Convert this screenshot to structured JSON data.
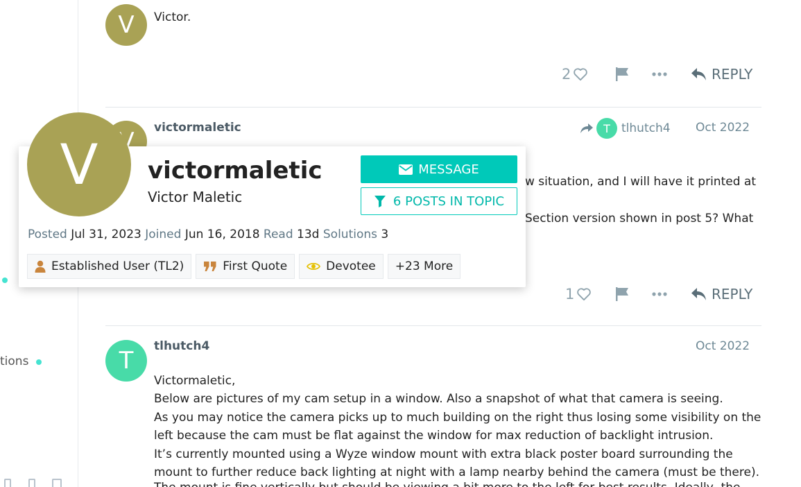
{
  "left_rail": {
    "partial_label": "tions"
  },
  "posts": [
    {
      "avatar_letter": "V",
      "avatar_color": "#a9a255",
      "body_lines": [
        "Victor."
      ],
      "likes": "2",
      "reply_label": "REPLY"
    },
    {
      "avatar_letter": "V",
      "avatar_color": "#a9a255",
      "username": "victormaletic",
      "reply_to": {
        "avatar_letter": "T",
        "avatar_color": "#48dba8",
        "name": "tlhutch4"
      },
      "date": "Oct 2022",
      "body_fragments": [
        "w situation, and I will have it printed at",
        "Section version shown in post 5? What"
      ],
      "likes": "1",
      "reply_label": "REPLY"
    },
    {
      "avatar_letter": "T",
      "avatar_color": "#48dba8",
      "username": "tlhutch4",
      "date": "Oct 2022",
      "body_lines": [
        "Victormaletic,",
        "Below are pictures of my cam setup in a window. Also a snapshot of what that camera is seeing.",
        "As you may notice the camera picks up to much building on the right thus losing some visibility on the",
        "left because the cam must be flat against the window for max reduction of backlight intrusion.",
        "It’s currently mounted using a Wyze window mount with extra black poster board surrounding the",
        "mount to further reduce back lighting at night with a lamp nearby behind the camera (must be there).",
        "The mount is fine vertically but should be viewing a bit more to the left for best results. Ideally, the"
      ]
    }
  ],
  "user_card": {
    "avatar_letter": "V",
    "avatar_color": "#a9a255",
    "username": "victormaletic",
    "full_name": "Victor Maletic",
    "message_button": "MESSAGE",
    "posts_in_topic_button": "6 POSTS IN TOPIC",
    "meta": {
      "posted_label": "Posted",
      "posted_value": "Jul 31, 2023",
      "joined_label": "Joined",
      "joined_value": "Jun 16, 2018",
      "read_label": "Read",
      "read_value": "13d",
      "solutions_label": "Solutions",
      "solutions_value": "3"
    },
    "badges": [
      {
        "label": "Established User (TL2)",
        "icon": "user-icon",
        "color": "#c9853d"
      },
      {
        "label": "First Quote",
        "icon": "quote-icon",
        "color": "#c9853d"
      },
      {
        "label": "Devotee",
        "icon": "eye-icon",
        "color": "#e5c000"
      },
      {
        "label": "+23 More"
      }
    ]
  },
  "colors": {
    "accent": "#00c9b9",
    "rail_dot": "#45e3d1"
  }
}
